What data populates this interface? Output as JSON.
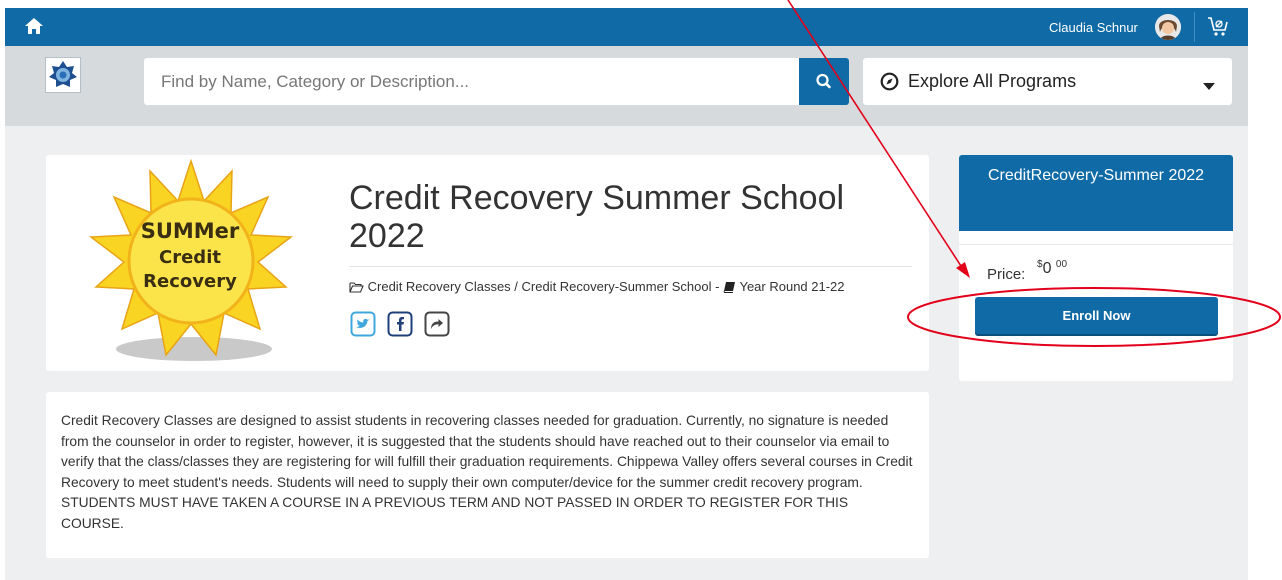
{
  "topbar": {
    "user_name": "Claudia Schnur",
    "icons": [
      "home-icon",
      "avatar",
      "cart-icon"
    ]
  },
  "search": {
    "placeholder": "Find by Name, Category or Description...",
    "value": "",
    "button_icon": "search-icon"
  },
  "explore": {
    "label": "Explore All Programs",
    "icon": "compass-icon"
  },
  "program": {
    "image_text": [
      "SUMMer",
      "Credit",
      "Recovery"
    ],
    "title": "Credit Recovery Summer School 2022",
    "breadcrumb_path": "Credit Recovery Classes / Credit Recovery-Summer School -",
    "breadcrumb_term": "Year Round 21-22",
    "share": [
      "twitter-icon",
      "facebook-icon",
      "share-icon"
    ],
    "description": "Credit Recovery Classes are designed to assist students in recovering classes needed for graduation. Currently, no signature is needed from the counselor in order to register, however, it is suggested that the students should have reached out to their counselor via email to verify that the class/classes they are registering for will fulfill their graduation requirements. Chippewa Valley offers several courses in Credit Recovery to meet student's needs.  Students will need to supply their own computer/device for the summer credit recovery program.  STUDENTS MUST HAVE TAKEN A COURSE IN A PREVIOUS TERM AND NOT PASSED IN ORDER TO REGISTER FOR THIS COURSE."
  },
  "enroll_card": {
    "header": "CreditRecovery-Summer 2022",
    "price_label": "Price:",
    "currency": "$",
    "price_whole": "0",
    "price_cents": "00",
    "enroll_label": "Enroll Now"
  },
  "colors": {
    "brand_blue": "#0f6aa5",
    "annotation_red": "#e3001b",
    "sun_yellow": "#f7d21a"
  }
}
